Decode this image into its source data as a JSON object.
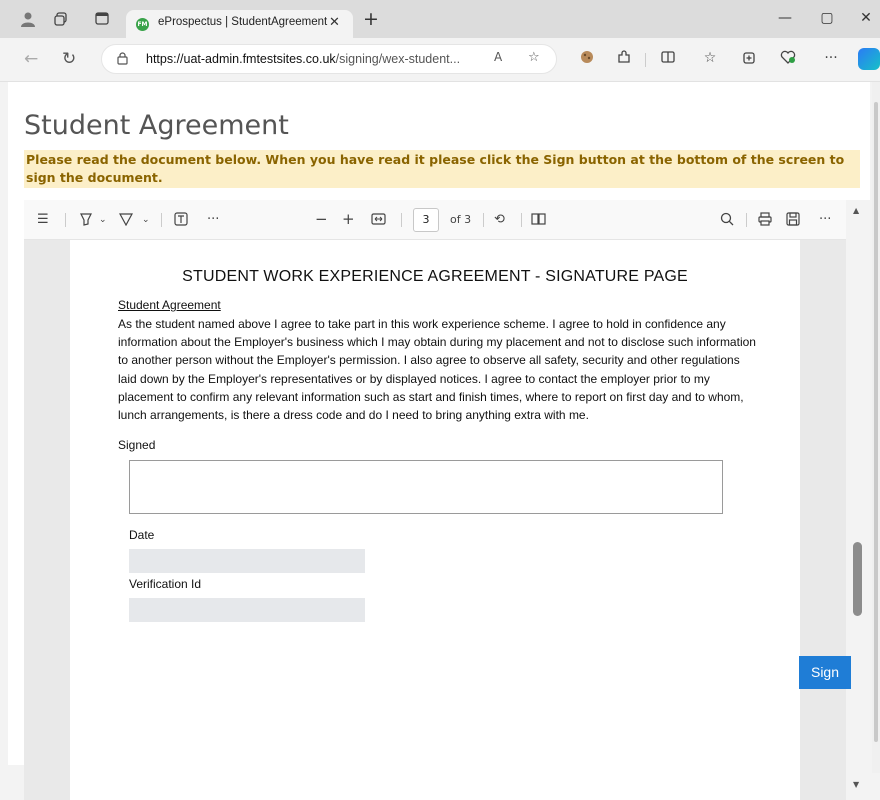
{
  "browser": {
    "tab_title": "eProspectus | StudentAgreement",
    "tab_close": "✕",
    "new_tab": "+",
    "favicon_text": "FM",
    "url_host": "https://uat-admin.fmtestsites.co.uk",
    "url_path": "/signing/wex-student...",
    "window_controls": [
      "—",
      "▢",
      "✕"
    ],
    "read_aloud": "A",
    "more": "···"
  },
  "page": {
    "title": "Student Agreement",
    "notice": "Please read the document below. When you have read it please click the Sign button at the bottom of the screen to sign the document."
  },
  "pdf_toolbar": {
    "current_page": "3",
    "of_pages": "of 3",
    "more": "···",
    "minus": "−",
    "plus": "+"
  },
  "document": {
    "title": "STUDENT WORK EXPERIENCE AGREEMENT - SIGNATURE PAGE",
    "section_heading": "Student Agreement",
    "body": "As the student named above I agree to take part in this work experience scheme. I agree to hold in confidence any information about the Employer's business which I may obtain during my placement and not to disclose such information to another person without the Employer's permission. I also agree to observe all safety, security and other regulations laid down by the Employer's representatives or by displayed notices. I agree to contact the employer prior to my placement to confirm any relevant information such as start and finish times, where to report on first day and to whom, lunch arrangements, is there a dress code and do I need to bring anything extra with me.",
    "signed_label": "Signed",
    "date_label": "Date",
    "verification_label": "Verification Id"
  },
  "actions": {
    "sign_label": "Sign"
  }
}
